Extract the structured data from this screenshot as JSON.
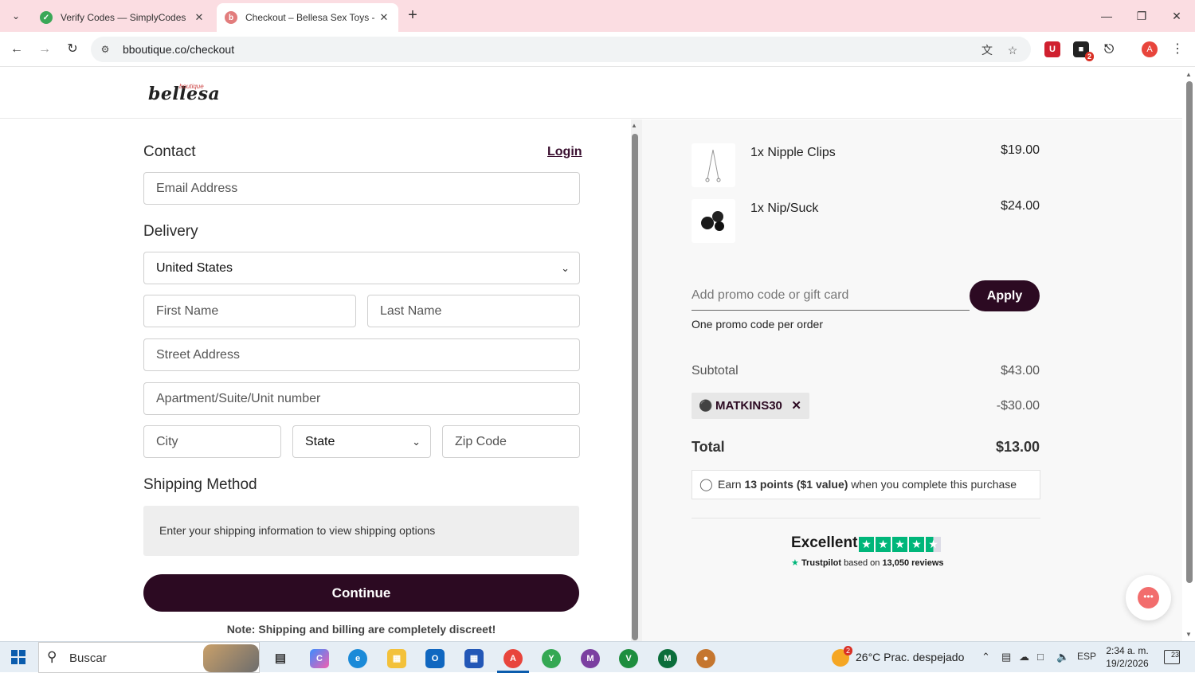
{
  "browser": {
    "tabs": [
      {
        "title": "Verify Codes — SimplyCodes",
        "favicon": "simplycodes-icon",
        "favicon_color": "#3aa757"
      },
      {
        "title": "Checkout – Bellesa Sex Toys - Sl",
        "favicon": "bellesa-icon",
        "favicon_color": "#e27d7d"
      }
    ],
    "url": "bboutique.co/checkout",
    "extension_badge": "2",
    "profile_initial": "A",
    "tabbar_color": "#fbdde2"
  },
  "header": {
    "logo": "bellesa",
    "logo_sup": "boutique"
  },
  "contact": {
    "title": "Contact",
    "login": "Login",
    "email_placeholder": "Email Address"
  },
  "delivery": {
    "title": "Delivery",
    "country": "United States",
    "first_name_placeholder": "First Name",
    "last_name_placeholder": "Last Name",
    "street_placeholder": "Street Address",
    "apt_placeholder": "Apartment/Suite/Unit number",
    "city_placeholder": "City",
    "state": "State",
    "zip_placeholder": "Zip Code"
  },
  "shipping": {
    "title": "Shipping Method",
    "info": "Enter your shipping information to view shipping options"
  },
  "continue_label": "Continue",
  "note": "Note: Shipping and billing are completely discreet!",
  "summary": {
    "items": [
      {
        "name": "1x Nipple Clips",
        "price": "$19.00"
      },
      {
        "name": "1x Nip/Suck",
        "price": "$24.00"
      }
    ],
    "promo_placeholder": "Add promo code or gift card",
    "apply_label": "Apply",
    "promo_note": "One promo code per order",
    "subtotal_label": "Subtotal",
    "subtotal_value": "$43.00",
    "code": "MATKINS30",
    "discount_value": "-$30.00",
    "total_label": "Total",
    "total_value": "$13.00",
    "points_pre": "Earn",
    "points_bold": "13 points ($1 value)",
    "points_post": "when you complete this purchase",
    "trustpilot_rating": "Excellent",
    "trustpilot_brand": "Trustpilot",
    "trustpilot_based": "based on",
    "trustpilot_reviews": "13,050 reviews",
    "trustpilot_stars": 4.5,
    "brand_color": "#2c0a22"
  },
  "taskbar": {
    "search_label": "Buscar",
    "weather_badge": "2",
    "weather": "26°C  Prac. despejado",
    "lang": "ESP",
    "time": "2:34 a. m.",
    "date": "19/2/2026",
    "notif_count": "23"
  }
}
